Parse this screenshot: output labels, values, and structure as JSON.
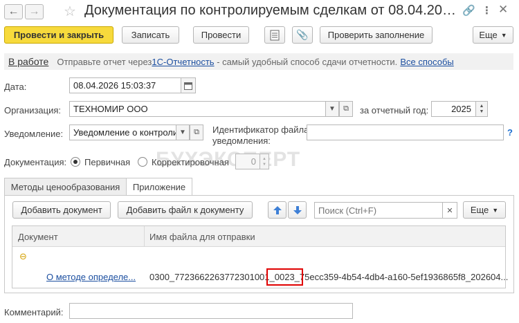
{
  "nav": {
    "back_icon": "arrow-left",
    "forward_icon": "arrow-right"
  },
  "window": {
    "title": "Документация по контролируемым сделкам от 08.04.2026 ...",
    "favorite_icon": "star",
    "link_icon": "link",
    "more_icon": "vertical-dots",
    "close_icon": "close"
  },
  "toolbar": {
    "post_and_close": "Провести и закрыть",
    "save": "Записать",
    "post": "Провести",
    "check": "Проверить заполнение",
    "more": "Еще"
  },
  "infobar": {
    "status": "В работе",
    "text_before": "Отправьте отчет через ",
    "link1": "1С-Отчетность",
    "text_after": " - самый удобный способ сдачи отчетности.",
    "link2": "Все способы"
  },
  "form": {
    "date_label": "Дата:",
    "date_value": "08.04.2026 15:03:37",
    "org_label": "Организация:",
    "org_value": "ТЕХНОМИР ООО",
    "year_label": "за отчетный год:",
    "year_value": "2025",
    "notice_label": "Уведомление:",
    "notice_value": "Уведомление о контроли",
    "notice_id_label_line1": "Идентификатор файла",
    "notice_id_label_line2": "уведомления:",
    "notice_id_value": "",
    "help": "?",
    "doc_label": "Документация:",
    "radio_primary": "Первичная",
    "radio_corrective": "Корректировочная",
    "corrective_number": "0",
    "comment_label": "Комментарий:",
    "comment_value": ""
  },
  "watermark": "БУХЭКСПЕРТ",
  "tabs": [
    {
      "label": "Методы ценообразования"
    },
    {
      "label": "Приложение"
    }
  ],
  "attachments": {
    "add_document": "Добавить документ",
    "add_file": "Добавить файл к документу",
    "search_placeholder": "Поиск (Ctrl+F)",
    "more": "Еще",
    "columns": [
      "Документ",
      "Имя файла для отправки"
    ],
    "group_toggle": "⊖",
    "rows": [
      {
        "document": "О методе определе...",
        "filename_prefix": "0300_7723662263772301001",
        "filename_highlight": "_0023_",
        "filename_suffix": "75ecc359-4b54-4db4-a160-5ef1936865f8_202604..."
      }
    ]
  },
  "colors": {
    "primary_button": "#f7da3c",
    "link": "#1c4fa0",
    "highlight_box": "#e00000",
    "arrow_buttons": "#3d7fd6"
  }
}
